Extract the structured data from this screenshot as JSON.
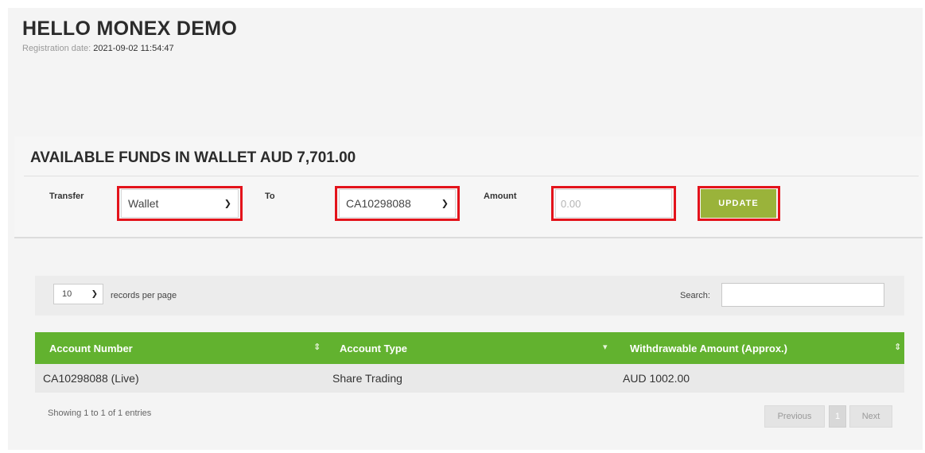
{
  "header": {
    "greeting": "HELLO MONEX DEMO",
    "registration_label": "Registration date:",
    "registration_value": "2021-09-02 11:54:47"
  },
  "funds": {
    "title": "AVAILABLE FUNDS IN WALLET AUD 7,701.00",
    "transfer_label": "Transfer",
    "transfer_value": "Wallet",
    "to_label": "To",
    "to_value": "CA10298088",
    "amount_label": "Amount",
    "amount_placeholder": "0.00",
    "update_label": "UPDATE"
  },
  "table": {
    "length_value": "10",
    "length_label": "records per page",
    "search_label": "Search:",
    "columns": [
      "Account Number",
      "Account Type",
      "Withdrawable Amount (Approx.)"
    ],
    "rows": [
      [
        "CA10298088 (Live)",
        "Share Trading",
        "AUD 1002.00"
      ]
    ],
    "info": "Showing 1 to 1 of 1 entries",
    "pagination": {
      "previous": "Previous",
      "current": "1",
      "next": "Next"
    }
  },
  "colors": {
    "header_green": "#62b22f",
    "button_olive": "#9ab33a",
    "highlight_red": "#e3131b"
  }
}
